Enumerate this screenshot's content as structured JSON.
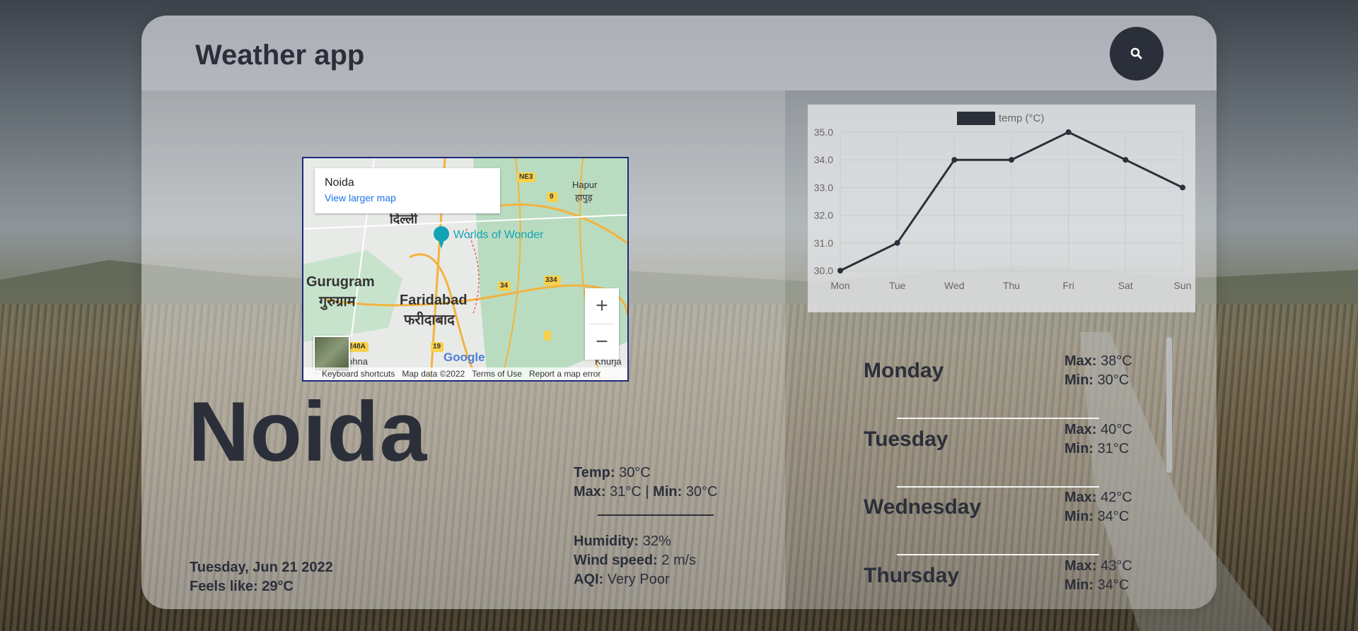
{
  "header": {
    "title": "Weather app",
    "search_icon": "search-icon"
  },
  "map": {
    "place": "Noida",
    "view_larger": "View larger map",
    "labels": {
      "delhi": "दिल्ली",
      "gurugram": "Gurugram",
      "gurugram_hi": "गुरुग्राम",
      "faridabad": "Faridabad",
      "faridabad_hi": "फरीदाबाद",
      "worlds_of_wonder": "Worlds of Wonder",
      "hapur": "Hapur",
      "hapur_hi": "हापुड़",
      "khurja": "Khurja",
      "ne3": "NE3",
      "r9": "9",
      "r34": "34",
      "r334": "334",
      "r19": "19",
      "r248a": "248A",
      "sohna": "ohna"
    },
    "zoom_in": "+",
    "zoom_out": "−",
    "footer": [
      "Keyboard shortcuts",
      "Map data ©2022",
      "Terms of Use",
      "Report a map error"
    ],
    "google": "Google"
  },
  "current": {
    "city": "Noida",
    "date": "Tuesday, Jun 21 2022",
    "feels_like_label": "Feels like:",
    "feels_like": "29°C",
    "temp_label": "Temp:",
    "temp": "30°C",
    "max_label": "Max:",
    "max": "31°C",
    "separator": "|",
    "min_label": "Min:",
    "min": "30°C",
    "humidity_label": "Humidity:",
    "humidity": "32%",
    "wind_label": "Wind speed:",
    "wind": "2 m/s",
    "aqi_label": "AQI:",
    "aqi": "Very Poor"
  },
  "chart_data": {
    "type": "line",
    "categories": [
      "Mon",
      "Tue",
      "Wed",
      "Thu",
      "Fri",
      "Sat",
      "Sun"
    ],
    "series": [
      {
        "name": "temp (°C)",
        "values": [
          30,
          31,
          34,
          34,
          35,
          34,
          33
        ]
      }
    ],
    "ylim": [
      30,
      35
    ],
    "yticks": [
      "30.0",
      "31.0",
      "32.0",
      "33.0",
      "34.0",
      "35.0"
    ],
    "grid": true,
    "legend": "top",
    "line_color": "#2b2f3a"
  },
  "forecast": [
    {
      "day": "Monday",
      "max_label": "Max:",
      "max": "38°C",
      "min_label": "Min:",
      "min": "30°C"
    },
    {
      "day": "Tuesday",
      "max_label": "Max:",
      "max": "40°C",
      "min_label": "Min:",
      "min": "31°C"
    },
    {
      "day": "Wednesday",
      "max_label": "Max:",
      "max": "42°C",
      "min_label": "Min:",
      "min": "34°C"
    },
    {
      "day": "Thursday",
      "max_label": "Max:",
      "max": "43°C",
      "min_label": "Min:",
      "min": "34°C"
    }
  ]
}
